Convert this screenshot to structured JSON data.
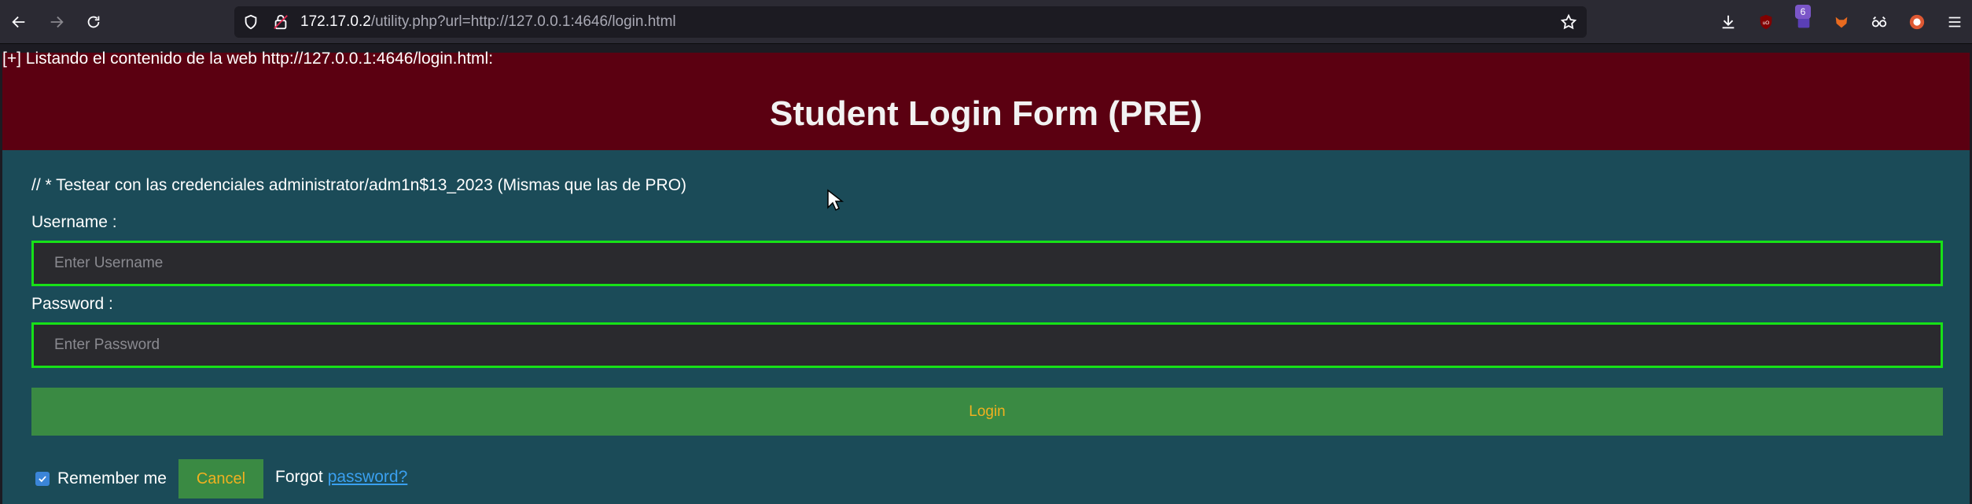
{
  "browser": {
    "url_host": "172.17.0.2",
    "url_path": "/utility.php?url=http://127.0.0.1:4646/login.html",
    "extension_badge": "6"
  },
  "page": {
    "listing_text": "[+] Listando el contenido de la web http://127.0.0.1:4646/login.html:",
    "title": "Student Login Form (PRE)",
    "note": "// * Testear con las credenciales administrator/adm1n$13_2023 (Mismas que las de PRO)",
    "username_label": "Username :",
    "username_placeholder": "Enter Username",
    "password_label": "Password :",
    "password_placeholder": "Enter Password",
    "login_label": "Login",
    "remember_label": "Remember me",
    "remember_checked": true,
    "cancel_label": "Cancel",
    "forgot_text": "Forgot",
    "forgot_link": "password?"
  },
  "colors": {
    "header_bg": "#5b0011",
    "form_bg": "#1b4b58",
    "field_border": "#17e117",
    "button_bg": "#3a8a43",
    "button_text": "#f0b020",
    "link": "#3aa0f0"
  },
  "icons": [
    "back-icon",
    "forward-icon",
    "reload-icon",
    "shield-icon",
    "lock-icon",
    "star-icon",
    "download-icon",
    "ublock-icon",
    "extension-icon",
    "fox-icon",
    "glasses-icon",
    "duckduckgo-icon",
    "menu-icon"
  ]
}
